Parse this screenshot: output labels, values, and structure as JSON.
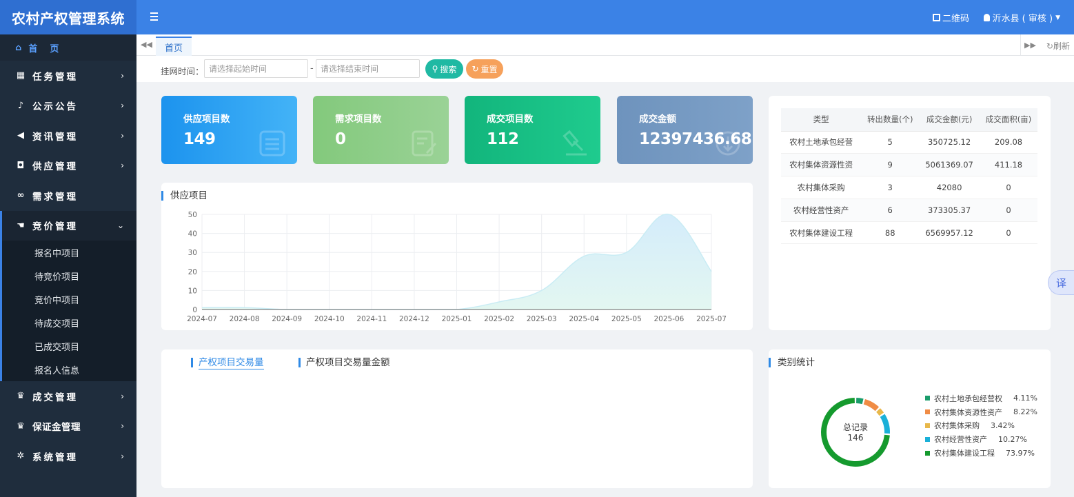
{
  "app": {
    "title": "农村产权管理系统"
  },
  "topbar": {
    "qr_label": "二维码",
    "user_label": "沂水县 ( 审核 )"
  },
  "sidebar": {
    "home_label": "首页",
    "items": [
      {
        "label": "任务管理",
        "icon": "calendar-icon"
      },
      {
        "label": "公示公告",
        "icon": "bell-icon"
      },
      {
        "label": "资讯管理",
        "icon": "bullhorn-icon"
      },
      {
        "label": "供应管理",
        "icon": "car-icon"
      },
      {
        "label": "需求管理",
        "icon": "handshake-icon"
      },
      {
        "label": "竞价管理",
        "icon": "hand-icon"
      },
      {
        "label": "成交管理",
        "icon": "trophy-icon"
      },
      {
        "label": "保证金管理",
        "icon": "trophy-icon"
      },
      {
        "label": "系统管理",
        "icon": "gear-icon"
      }
    ],
    "submenu": [
      "报名中项目",
      "待竞价项目",
      "竞价中项目",
      "待成交项目",
      "已成交项目",
      "报名人信息"
    ]
  },
  "tabs": {
    "home": "首页",
    "refresh": "刷新"
  },
  "filter": {
    "label": "挂网时间：",
    "start_placeholder": "请选择起始时间",
    "separator": "-",
    "end_placeholder": "请选择结束时间",
    "search_label": "搜索",
    "reset_label": "重置"
  },
  "stats": [
    {
      "title": "供应项目数",
      "value": "149"
    },
    {
      "title": "需求项目数",
      "value": "0"
    },
    {
      "title": "成交项目数",
      "value": "112"
    },
    {
      "title": "成交金额",
      "value": "12397436.68"
    }
  ],
  "chart_data": {
    "type": "area",
    "title": "供应项目",
    "categories": [
      "2024-07",
      "2024-08",
      "2024-09",
      "2024-10",
      "2024-11",
      "2024-12",
      "2025-01",
      "2025-02",
      "2025-03",
      "2025-04",
      "2025-05",
      "2025-06",
      "2025-07"
    ],
    "series": [
      {
        "values": [
          1,
          1,
          0,
          0,
          0,
          0,
          0,
          4,
          10,
          28,
          30,
          50,
          20
        ]
      }
    ],
    "ylim": [
      0,
      50
    ],
    "yticks": [
      0,
      10,
      20,
      30,
      40,
      50
    ],
    "grid": true,
    "colors": {
      "line": "#c9ecf4",
      "fill_top": "#d4ecfb",
      "fill_bottom": "#e3f7f1"
    }
  },
  "table": {
    "headers": [
      "类型",
      "转出数量(个)",
      "成交金额(元)",
      "成交面积(亩)"
    ],
    "rows": [
      [
        "农村土地承包经营",
        "5",
        "350725.12",
        "209.08"
      ],
      [
        "农村集体资源性资",
        "9",
        "5061369.07",
        "411.18"
      ],
      [
        "农村集体采购",
        "3",
        "42080",
        "0"
      ],
      [
        "农村经营性资产",
        "6",
        "373305.37",
        "0"
      ],
      [
        "农村集体建设工程",
        "88",
        "6569957.12",
        "0"
      ]
    ]
  },
  "bottom": {
    "tab1": "产权项目交易量",
    "tab2": "产权项目交易量金额",
    "category_title": "类别统计"
  },
  "donut": {
    "center_label": "总记录",
    "total": "146",
    "slices": [
      {
        "name": "农村土地承包经营权",
        "percent_label": "4.11%",
        "value": 4.11,
        "color": "#1a9c6b"
      },
      {
        "name": "农村集体资源性资产",
        "percent_label": "8.22%",
        "value": 8.22,
        "color": "#f08c45"
      },
      {
        "name": "农村集体采购",
        "percent_label": "3.42%",
        "value": 3.42,
        "color": "#e8b84a"
      },
      {
        "name": "农村经营性资产",
        "percent_label": "10.27%",
        "value": 10.27,
        "color": "#1ab0d8"
      },
      {
        "name": "农村集体建设工程",
        "percent_label": "73.97%",
        "value": 73.97,
        "color": "#159a2e"
      }
    ]
  },
  "translate_label": "译"
}
